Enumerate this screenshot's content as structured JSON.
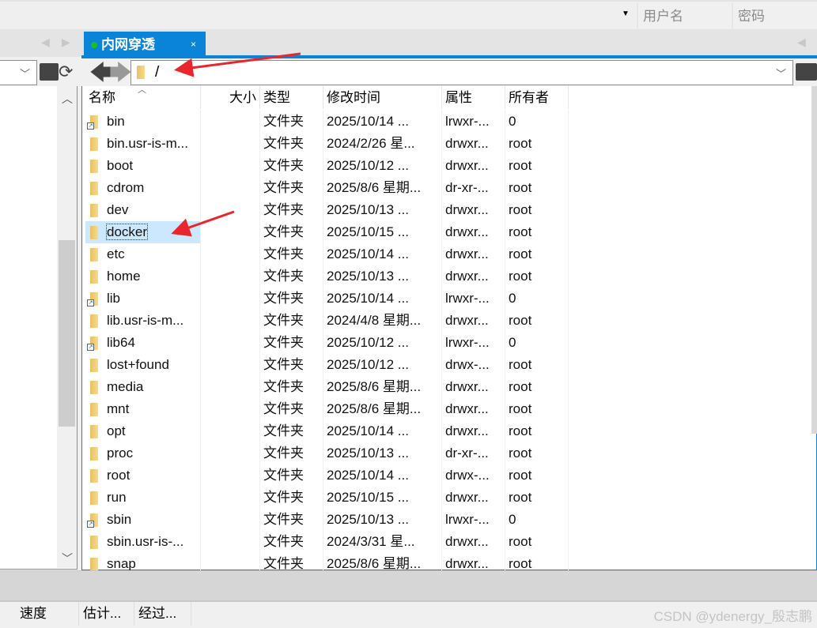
{
  "topbar": {
    "username_placeholder": "用户名",
    "password_placeholder": "密码"
  },
  "tab": {
    "title": "内网穿透",
    "close": "×",
    "status_color": "#1dbf1d"
  },
  "accent": "#0a84d8",
  "path": {
    "value": "/"
  },
  "columns": [
    "名称",
    "大小",
    "类型",
    "修改时间",
    "属性",
    "所有者"
  ],
  "files": [
    {
      "name": "bin",
      "link": true,
      "type": "文件夹",
      "mtime": "2025/10/14 ...",
      "attr": "lrwxr-...",
      "owner": "0"
    },
    {
      "name": "bin.usr-is-m...",
      "type": "文件夹",
      "mtime": "2024/2/26 星...",
      "attr": "drwxr...",
      "owner": "root"
    },
    {
      "name": "boot",
      "type": "文件夹",
      "mtime": "2025/10/12 ...",
      "attr": "drwxr...",
      "owner": "root"
    },
    {
      "name": "cdrom",
      "type": "文件夹",
      "mtime": "2025/8/6 星期...",
      "attr": "dr-xr-...",
      "owner": "root"
    },
    {
      "name": "dev",
      "type": "文件夹",
      "mtime": "2025/10/13 ...",
      "attr": "drwxr...",
      "owner": "root"
    },
    {
      "name": "docker",
      "selected": true,
      "type": "文件夹",
      "mtime": "2025/10/15 ...",
      "attr": "drwxr...",
      "owner": "root"
    },
    {
      "name": "etc",
      "type": "文件夹",
      "mtime": "2025/10/14 ...",
      "attr": "drwxr...",
      "owner": "root"
    },
    {
      "name": "home",
      "type": "文件夹",
      "mtime": "2025/10/13 ...",
      "attr": "drwxr...",
      "owner": "root"
    },
    {
      "name": "lib",
      "link": true,
      "type": "文件夹",
      "mtime": "2025/10/14 ...",
      "attr": "lrwxr-...",
      "owner": "0"
    },
    {
      "name": "lib.usr-is-m...",
      "type": "文件夹",
      "mtime": "2024/4/8 星期...",
      "attr": "drwxr...",
      "owner": "root"
    },
    {
      "name": "lib64",
      "link": true,
      "type": "文件夹",
      "mtime": "2025/10/12 ...",
      "attr": "lrwxr-...",
      "owner": "0"
    },
    {
      "name": "lost+found",
      "type": "文件夹",
      "mtime": "2025/10/12 ...",
      "attr": "drwx-...",
      "owner": "root"
    },
    {
      "name": "media",
      "type": "文件夹",
      "mtime": "2025/8/6 星期...",
      "attr": "drwxr...",
      "owner": "root"
    },
    {
      "name": "mnt",
      "type": "文件夹",
      "mtime": "2025/8/6 星期...",
      "attr": "drwxr...",
      "owner": "root"
    },
    {
      "name": "opt",
      "type": "文件夹",
      "mtime": "2025/10/14 ...",
      "attr": "drwxr...",
      "owner": "root"
    },
    {
      "name": "proc",
      "type": "文件夹",
      "mtime": "2025/10/13 ...",
      "attr": "dr-xr-...",
      "owner": "root"
    },
    {
      "name": "root",
      "type": "文件夹",
      "mtime": "2025/10/14 ...",
      "attr": "drwx-...",
      "owner": "root"
    },
    {
      "name": "run",
      "type": "文件夹",
      "mtime": "2025/10/15 ...",
      "attr": "drwxr...",
      "owner": "root"
    },
    {
      "name": "sbin",
      "link": true,
      "type": "文件夹",
      "mtime": "2025/10/13 ...",
      "attr": "lrwxr-...",
      "owner": "0"
    },
    {
      "name": "sbin.usr-is-...",
      "type": "文件夹",
      "mtime": "2024/3/31 星...",
      "attr": "drwxr...",
      "owner": "root"
    },
    {
      "name": "snap",
      "type": "文件夹",
      "mtime": "2025/8/6 星期...",
      "attr": "drwxr...",
      "owner": "root"
    }
  ],
  "status": {
    "speed": "速度",
    "estimate": "估计...",
    "elapsed": "经过..."
  },
  "watermark": "CSDN @ydenergy_殷志鹏"
}
